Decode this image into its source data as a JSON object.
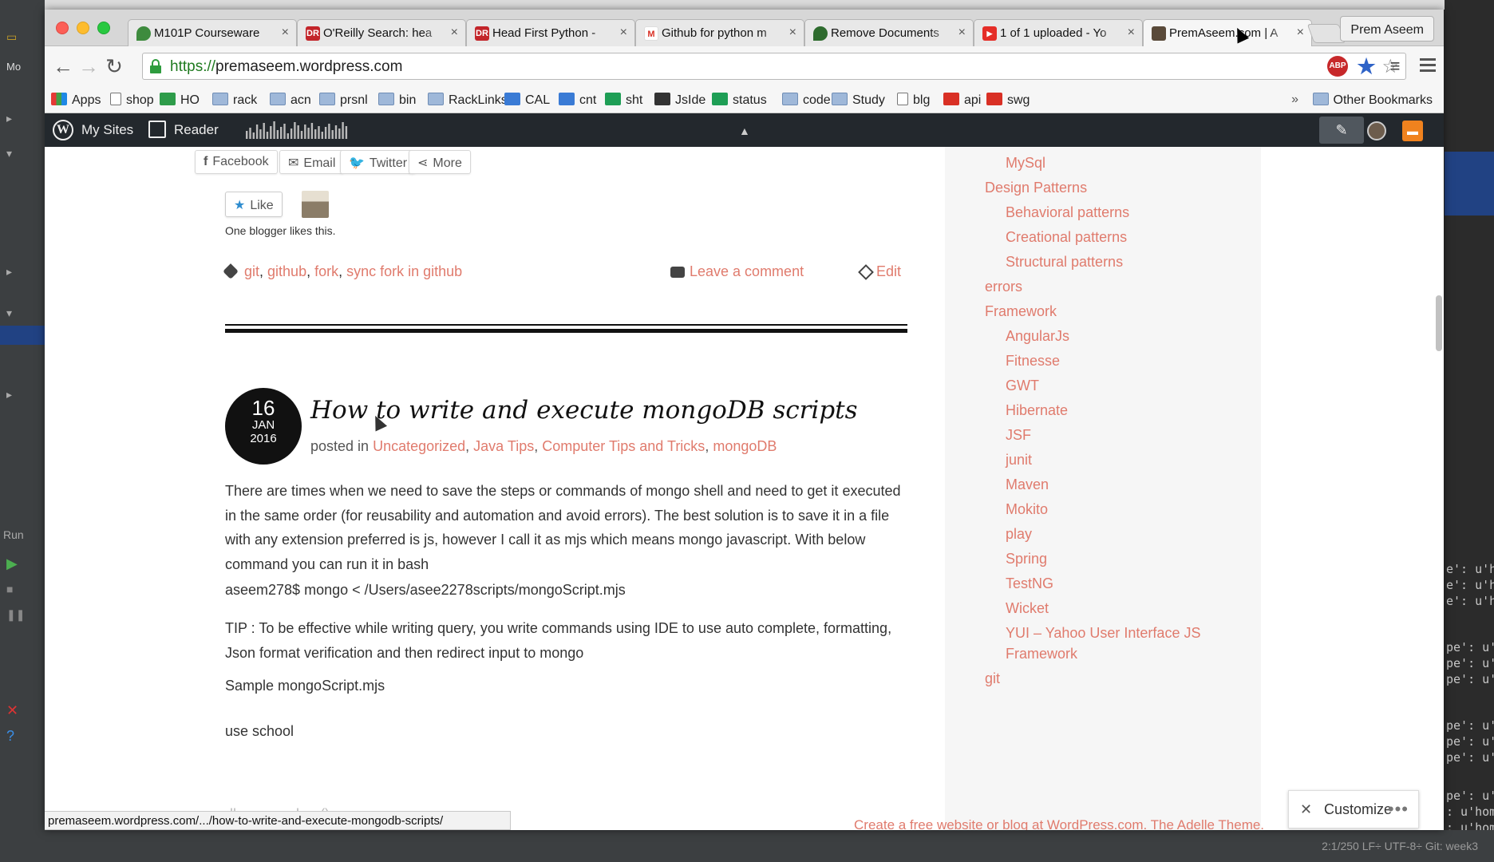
{
  "browser": {
    "tabs": [
      {
        "label": "M101P Courseware",
        "favicon_color": "#3e8b3e"
      },
      {
        "label": "O'Reilly Search: hea",
        "favicon_color": "#c3252a",
        "favicon_text": "DR"
      },
      {
        "label": "Head First Python -",
        "favicon_color": "#c3252a",
        "favicon_text": "DR"
      },
      {
        "label": "Github for python m",
        "favicon_color": "#d93025",
        "favicon_text": "M"
      },
      {
        "label": "Remove Documents",
        "favicon_color": "#2e6b2e"
      },
      {
        "label": "1 of 1 uploaded - Yo",
        "favicon_color": "#e52d27"
      },
      {
        "label": "PremAseem.com | A",
        "favicon_color": "#5a4a3a",
        "active": true
      }
    ],
    "profile_name": "Prem Aseem",
    "url_scheme": "https://",
    "url_host": "premaseem.wordpress.com",
    "bookmarks": [
      {
        "label": "Apps",
        "icon": "apps-grid-icon"
      },
      {
        "label": "shop",
        "icon": "page-icon"
      },
      {
        "label": "HO",
        "icon": "ho-icon"
      },
      {
        "label": "rack",
        "icon": "folder-icon"
      },
      {
        "label": "acn",
        "icon": "folder-icon"
      },
      {
        "label": "prsnl",
        "icon": "folder-icon"
      },
      {
        "label": "bin",
        "icon": "folder-icon"
      },
      {
        "label": "RackLinks",
        "icon": "folder-icon"
      },
      {
        "label": "CAL",
        "icon": "calendar-icon"
      },
      {
        "label": "cnt",
        "icon": "contacts-icon"
      },
      {
        "label": "sht",
        "icon": "sheet-icon"
      },
      {
        "label": "JsIde",
        "icon": "download-icon"
      },
      {
        "label": "status",
        "icon": "sheet-icon"
      },
      {
        "label": "code",
        "icon": "folder-icon"
      },
      {
        "label": "Study",
        "icon": "folder-icon"
      },
      {
        "label": "blg",
        "icon": "page-icon"
      },
      {
        "label": "api",
        "icon": "angular-icon"
      },
      {
        "label": "swg",
        "icon": "spinner-icon"
      }
    ],
    "bookmarks_overflow": "»",
    "other_bookmarks": "Other Bookmarks",
    "status_url": "premaseem.wordpress.com/.../how-to-write-and-execute-mongodb-scripts/"
  },
  "wp_admin_bar": {
    "my_sites": "My Sites",
    "reader": "Reader"
  },
  "post_prev": {
    "share_buttons": [
      "Facebook",
      "Email",
      "Twitter",
      "More"
    ],
    "like_label": "Like",
    "likes_text": "One blogger likes this.",
    "tags": [
      "git",
      "github",
      "fork",
      "sync fork in github"
    ],
    "leave_comment": "Leave a comment",
    "edit": "Edit"
  },
  "post": {
    "day": "16",
    "month": "JAN",
    "year": "2016",
    "title": "How to write and execute mongoDB scripts",
    "posted_in_label": "posted in",
    "categories": [
      "Uncategorized",
      "Java Tips",
      "Computer Tips and Tricks",
      "mongoDB"
    ],
    "paragraphs": [
      "There are times when we need to save the steps or commands of mongo shell and need to get it executed in the same order (for reusability and automation and avoid errors). The best solution is to save it in a file with any extension preferred is js, however I call it as mjs which means mongo javascript. With below command you can run it in bash",
      "aseem278$ mongo < /Users/asee2278scripts/mongoScript.mjs",
      "TIP : To be effective while writing query, you write commands using IDE to use auto complete, formatting, Json format verification and then redirect input to mongo",
      "Sample mongoScript.mjs",
      "use school"
    ],
    "faded_line": "db.scores.drop()"
  },
  "sidebar": {
    "items": [
      {
        "label": "MySql",
        "level": 2
      },
      {
        "label": "Design Patterns",
        "level": 1
      },
      {
        "label": "Behavioral patterns",
        "level": 2
      },
      {
        "label": "Creational patterns",
        "level": 2
      },
      {
        "label": "Structural patterns",
        "level": 2
      },
      {
        "label": "errors",
        "level": 1
      },
      {
        "label": "Framework",
        "level": 1
      },
      {
        "label": "AngularJs",
        "level": 2
      },
      {
        "label": "Fitnesse",
        "level": 2
      },
      {
        "label": "GWT",
        "level": 2
      },
      {
        "label": "Hibernate",
        "level": 2
      },
      {
        "label": "JSF",
        "level": 2
      },
      {
        "label": "junit",
        "level": 2
      },
      {
        "label": "Maven",
        "level": 2
      },
      {
        "label": "Mokito",
        "level": 2
      },
      {
        "label": "play",
        "level": 2
      },
      {
        "label": "Spring",
        "level": 2
      },
      {
        "label": "TestNG",
        "level": 2
      },
      {
        "label": "Wicket",
        "level": 2
      },
      {
        "label": "YUI – Yahoo User Interface JS",
        "level": 2
      },
      {
        "label": "Framework",
        "level": 2
      },
      {
        "label": "git",
        "level": 1
      }
    ]
  },
  "footer": {
    "credit": "Create a free website or blog at WordPress.com. The Adelle Theme.",
    "customize": "Customize"
  },
  "ide": {
    "status_text": "2:1/250   LF÷   UTF-8÷   Git: week3",
    "terminal_lines": [
      "e': u'h",
      "e': u'h",
      "e': u'h",
      "pe': u'",
      "pe': u'",
      "pe': u'",
      "pe': u'",
      "pe': u'",
      "pe': u'",
      "pe': u'",
      ": u'hom",
      ": u'hom"
    ],
    "run_label": "Run",
    "project_label": "Mo"
  },
  "colors": {
    "link": "#e07b6d",
    "wp_bar": "#23282d",
    "accent_orange": "#f0821e"
  }
}
